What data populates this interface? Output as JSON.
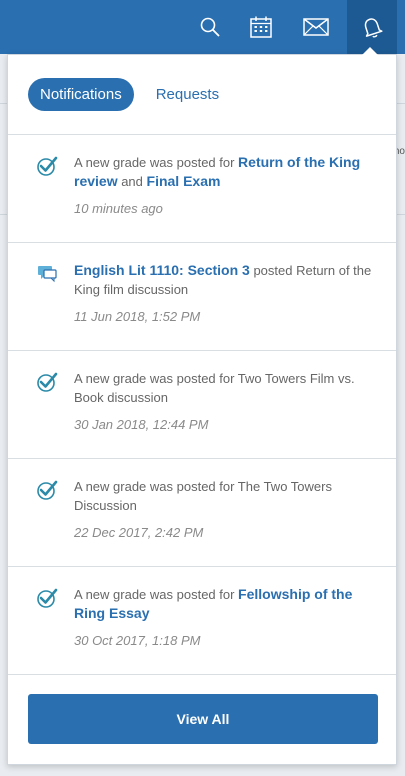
{
  "topbar": {
    "icons": [
      "search-icon",
      "calendar-icon",
      "mail-icon",
      "bell-icon"
    ],
    "accent": "#2a6fb0"
  },
  "background": {
    "snippet": "ho"
  },
  "tabs": [
    {
      "label": "Notifications",
      "active": true
    },
    {
      "label": "Requests",
      "active": false
    }
  ],
  "notifications": [
    {
      "icon": "check-icon",
      "prefix": "A new grade was posted for ",
      "link1": "Return of the King review",
      "middle": " and ",
      "link2": "Final Exam",
      "suffix": "",
      "time": "10 minutes ago"
    },
    {
      "icon": "comment-icon",
      "prefix": "",
      "link1": "English Lit 1110: Section 3",
      "middle": " posted Return of the King film discussion",
      "link2": "",
      "suffix": "",
      "time": "11 Jun 2018, 1:52 PM"
    },
    {
      "icon": "check-icon",
      "prefix": "A new grade was posted for Two Towers Film vs. Book discussion",
      "link1": "",
      "middle": "",
      "link2": "",
      "suffix": "",
      "time": "30 Jan 2018, 12:44 PM"
    },
    {
      "icon": "check-icon",
      "prefix": "A new grade was posted for The Two Towers Discussion",
      "link1": "",
      "middle": "",
      "link2": "",
      "suffix": "",
      "time": "22 Dec 2017, 2:42 PM"
    },
    {
      "icon": "check-icon",
      "prefix": "A new grade was posted for ",
      "link1": "Fellowship of the Ring Essay",
      "middle": "",
      "link2": "",
      "suffix": "",
      "time": "30 Oct 2017, 1:18 PM"
    }
  ],
  "footer": {
    "view_all_label": "View All"
  }
}
